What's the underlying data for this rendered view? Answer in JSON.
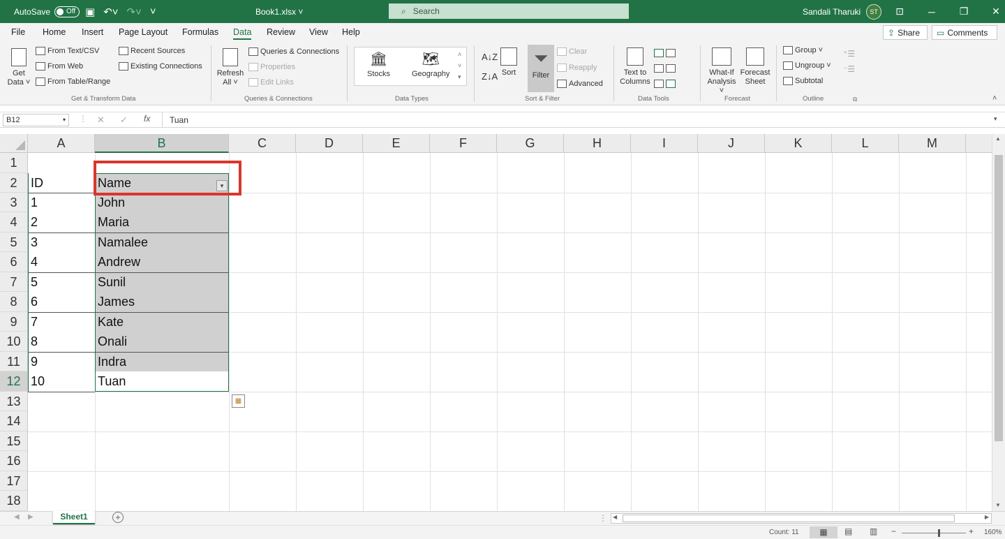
{
  "titlebar": {
    "autosave_label": "AutoSave",
    "autosave_state": "Off",
    "filename": "Book1.xlsx ˅",
    "search_placeholder": "Search",
    "user_name": "Sandali Tharuki",
    "user_initials": "ST"
  },
  "menu": {
    "tabs": [
      "File",
      "Home",
      "Insert",
      "Page Layout",
      "Formulas",
      "Data",
      "Review",
      "View",
      "Help"
    ],
    "active_tab": "Data",
    "share_label": "Share",
    "comments_label": "Comments"
  },
  "ribbon": {
    "get_data": {
      "get_data_label": "Get Data ˅",
      "from_text_csv": "From Text/CSV",
      "from_web": "From Web",
      "from_table_range": "From Table/Range",
      "recent_sources": "Recent Sources",
      "existing_connections": "Existing Connections",
      "group_label": "Get & Transform Data"
    },
    "queries": {
      "refresh_all": "Refresh All ˅",
      "queries_connections": "Queries & Connections",
      "properties": "Properties",
      "edit_links": "Edit Links",
      "group_label": "Queries & Connections"
    },
    "data_types": {
      "stocks": "Stocks",
      "geography": "Geography",
      "group_label": "Data Types"
    },
    "sort_filter": {
      "sort": "Sort",
      "filter": "Filter",
      "clear": "Clear",
      "reapply": "Reapply",
      "advanced": "Advanced",
      "group_label": "Sort & Filter"
    },
    "data_tools": {
      "text_to_columns": "Text to Columns",
      "group_label": "Data Tools"
    },
    "forecast": {
      "what_if": "What-If Analysis ˅",
      "forecast_sheet": "Forecast Sheet",
      "group_label": "Forecast"
    },
    "outline": {
      "group": "Group",
      "ungroup": "Ungroup",
      "subtotal": "Subtotal",
      "group_label": "Outline"
    }
  },
  "formula_bar": {
    "name_box": "B12",
    "formula": "Tuan"
  },
  "sheet": {
    "columns": [
      "A",
      "B",
      "C",
      "D",
      "E",
      "F",
      "G",
      "H",
      "I",
      "J",
      "K",
      "L",
      "M"
    ],
    "rows": [
      "1",
      "2",
      "3",
      "4",
      "5",
      "6",
      "7",
      "8",
      "9",
      "10",
      "11",
      "12",
      "13",
      "14",
      "15",
      "16",
      "17",
      "18"
    ],
    "header": [
      "ID",
      "Name"
    ],
    "data": [
      [
        "1",
        "John"
      ],
      [
        "2",
        "Maria"
      ],
      [
        "3",
        "Namalee"
      ],
      [
        "4",
        "Andrew"
      ],
      [
        "5",
        "Sunil"
      ],
      [
        "6",
        "James"
      ],
      [
        "7",
        "Kate"
      ],
      [
        "8",
        "Onali"
      ],
      [
        "9",
        "Indra"
      ],
      [
        "10",
        "Tuan"
      ]
    ],
    "selected_cell": "B12",
    "highlight_color": "#d9362b"
  },
  "sheet_tabs": {
    "tabs": [
      "Sheet1"
    ],
    "active": "Sheet1"
  },
  "status": {
    "count": "Count: 11",
    "zoom": "160%"
  }
}
